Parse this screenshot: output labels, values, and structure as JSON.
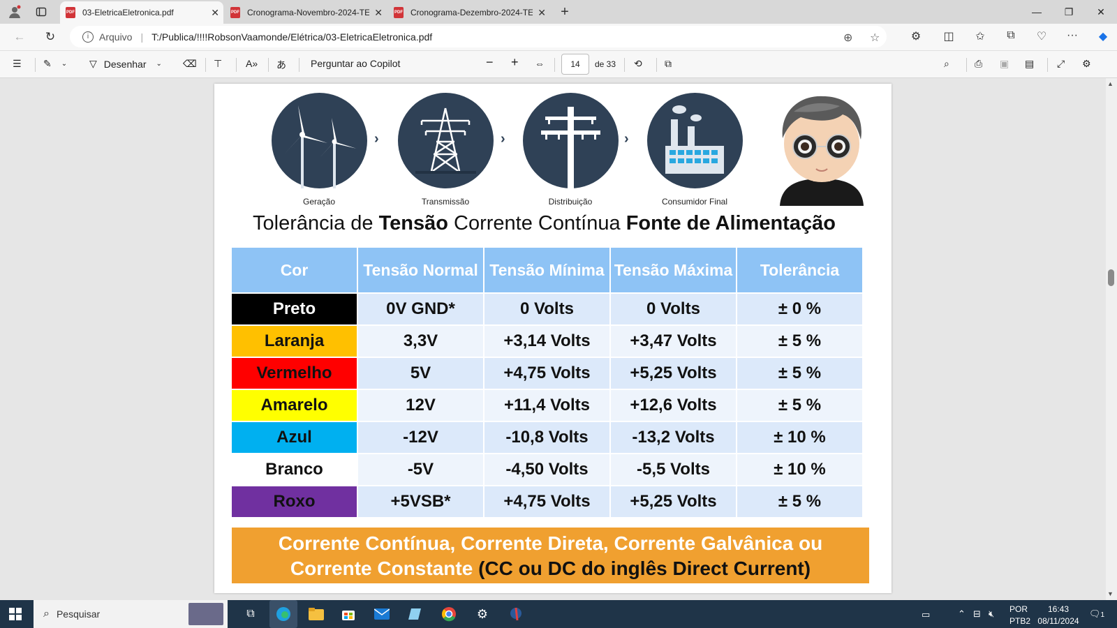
{
  "browser": {
    "tabs": [
      {
        "title": "03-EletricaEletronica.pdf",
        "active": true
      },
      {
        "title": "Cronograma-Novembro-2024-TE",
        "active": false
      },
      {
        "title": "Cronograma-Dezembro-2024-TE",
        "active": false
      }
    ],
    "address": {
      "label": "Arquivo",
      "url": "T:/Publica/!!!!RobsonVaamonde/Elétrica/03-EletricaEletronica.pdf"
    }
  },
  "pdf_toolbar": {
    "draw_label": "Desenhar",
    "copilot_label": "Perguntar ao Copilot",
    "page_number": "14",
    "page_total": "de 33",
    "zoom_out": "−",
    "zoom_in": "+"
  },
  "document": {
    "stages": [
      "Geração",
      "Transmissão",
      "Distribuição",
      "Consumidor Final"
    ],
    "title": {
      "part1": "Tolerância de ",
      "part2": "Tensão",
      "part3": " Corrente Contínua ",
      "part4": "Fonte de Alimentação"
    },
    "headers": [
      "Cor",
      "Tensão Normal",
      "Tensão Mínima",
      "Tensão Máxima",
      "Tolerância"
    ],
    "rows": [
      {
        "cor": "Preto",
        "normal": "0V GND*",
        "min": "0 Volts",
        "max": "0 Volts",
        "tol": "± 0 %",
        "bg": "#000000",
        "fg": "#ffffff"
      },
      {
        "cor": "Laranja",
        "normal": "3,3V",
        "min": "+3,14 Volts",
        "max": "+3,47 Volts",
        "tol": "± 5 %",
        "bg": "#ffc000",
        "fg": "#111111"
      },
      {
        "cor": "Vermelho",
        "normal": "5V",
        "min": "+4,75 Volts",
        "max": "+5,25 Volts",
        "tol": "± 5 %",
        "bg": "#ff0000",
        "fg": "#111111"
      },
      {
        "cor": "Amarelo",
        "normal": "12V",
        "min": "+11,4 Volts",
        "max": "+12,6 Volts",
        "tol": "± 5 %",
        "bg": "#ffff00",
        "fg": "#111111"
      },
      {
        "cor": "Azul",
        "normal": "-12V",
        "min": "-10,8 Volts",
        "max": "-13,2 Volts",
        "tol": "± 10 %",
        "bg": "#00b0f0",
        "fg": "#111111"
      },
      {
        "cor": "Branco",
        "normal": "-5V",
        "min": "-4,50 Volts",
        "max": "-5,5 Volts",
        "tol": "± 10 %",
        "bg": "#ffffff",
        "fg": "#111111"
      },
      {
        "cor": "Roxo",
        "normal": "+5VSB*",
        "min": "+4,75 Volts",
        "max": "+5,25 Volts",
        "tol": "± 5 %",
        "bg": "#7030a0",
        "fg": "#111111"
      }
    ],
    "footer_line1": "Corrente Contínua, Corrente Direta, Corrente Galvânica ou",
    "footer_line2a": "Corrente Constante ",
    "footer_line2b": "(CC ou DC do inglês Direct Current)"
  },
  "taskbar": {
    "search_placeholder": "Pesquisar",
    "lang": "POR",
    "layout": "PTB2",
    "time": "16:43",
    "date": "08/11/2024",
    "notifications": "1"
  },
  "colors": {
    "header_blue": "#8ec3f5",
    "row_light": "#dce9fa",
    "row_lighter": "#eef4fc",
    "footer_orange": "#f0a030",
    "circle_dark": "#2f4156"
  }
}
